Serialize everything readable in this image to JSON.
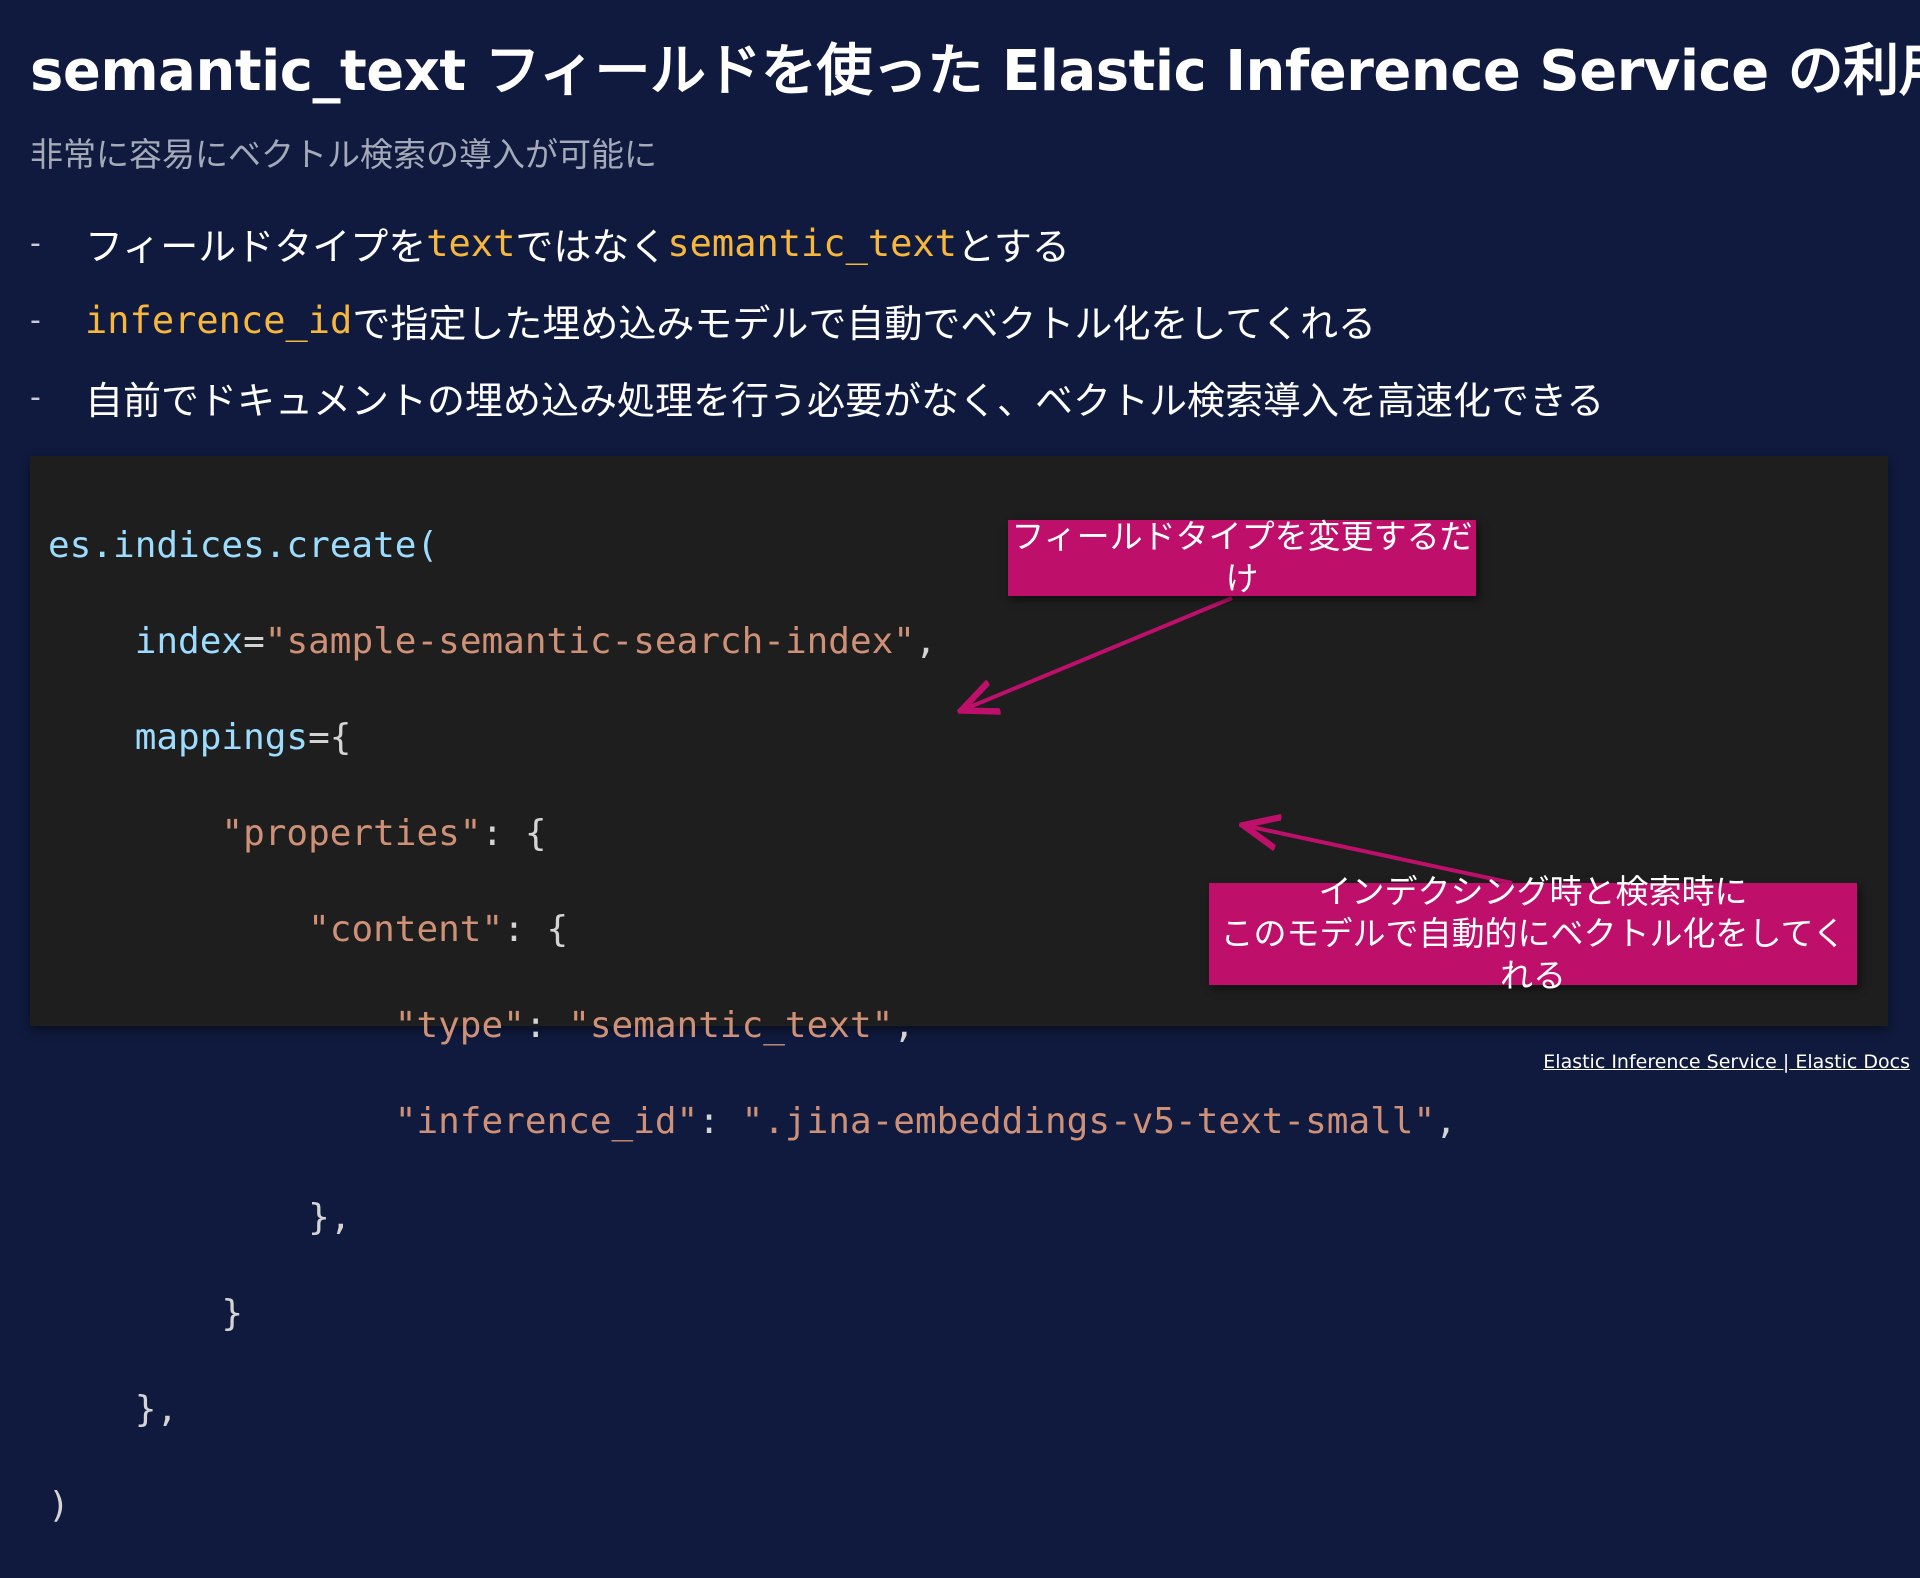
{
  "slide": {
    "title": "semantic_text フィールドを使った Elastic Inference Service の利用",
    "subtitle": "非常に容易にベクトル検索の導入が可能に"
  },
  "bullets": [
    {
      "dash": "-",
      "pre": "フィールドタイプを ",
      "code1": "text",
      "mid": " ではなく ",
      "code2": "semantic_text",
      "post": " とする"
    },
    {
      "dash": "-",
      "code1": "inference_id",
      "post": " で指定した埋め込みモデルで自動でベクトル化をしてくれる"
    },
    {
      "dash": "-",
      "text": "自前でドキュメントの埋め込み処理を行う必要がなく、ベクトル検索導入を高速化できる"
    }
  ],
  "code": {
    "l1": "es.indices.create(",
    "l2_key": "index",
    "l2_eq": "=",
    "l2_val": "\"sample-semantic-search-index\"",
    "l2_end": ",",
    "l3_key": "mappings",
    "l3_rest": "={",
    "l4_key": "\"properties\"",
    "l4_rest": ": {",
    "l5_key": "\"content\"",
    "l5_rest": ": {",
    "l6_key": "\"type\"",
    "l6_sep": ": ",
    "l6_val": "\"semantic_text\"",
    "l6_end": ",",
    "l7_key": "\"inference_id\"",
    "l7_sep": ": ",
    "l7_val": "\".jina-embeddings-v5-text-small\"",
    "l7_end": ",",
    "l8": "},",
    "l9": "}",
    "l10": "},",
    "l11": ")"
  },
  "callouts": {
    "field_type": "フィールドタイプを変更するだけ",
    "model_line1": "インデクシング時と検索時に",
    "model_line2": "このモデルで自動的にベクトル化をしてくれる"
  },
  "footer": {
    "link": "Elastic Inference Service | Elastic Docs"
  },
  "colors": {
    "background": "#0f1a3e",
    "code_panel": "#1e1e1e",
    "inline_code": "#f6b73c",
    "callout": "#be0f6b"
  }
}
